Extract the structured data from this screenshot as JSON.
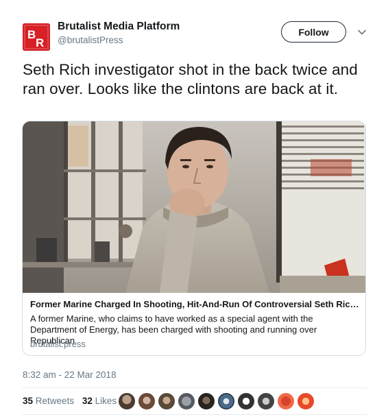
{
  "account": {
    "name": "Brutalist Media Platform",
    "handle": "@brutalistPress",
    "avatar_letters": "BR",
    "avatar_color": "#d71f26"
  },
  "actions": {
    "follow_label": "Follow",
    "caret_icon": "chevron-down-icon"
  },
  "tweet": {
    "text": "Seth Rich investigator shot in the back twice and ran over. Looks like the clintons are back at it."
  },
  "card": {
    "title": "Former Marine Charged In Shooting, Hit-And-Run Of Controversial Seth Rich ...",
    "description": "A former Marine, who claims to have worked as a special agent with the Department of Energy, has been charged with shooting and running over Republican",
    "domain": "brutalist.press"
  },
  "meta": {
    "timestamp": "8:32 am - 22 Mar 2018"
  },
  "stats": {
    "retweets_count": "35",
    "retweets_label": "Retweets",
    "likes_count": "32",
    "likes_label": "Likes"
  },
  "colors": {
    "text_primary": "#14171a",
    "text_secondary": "#657786",
    "border": "#e6ecf0"
  }
}
